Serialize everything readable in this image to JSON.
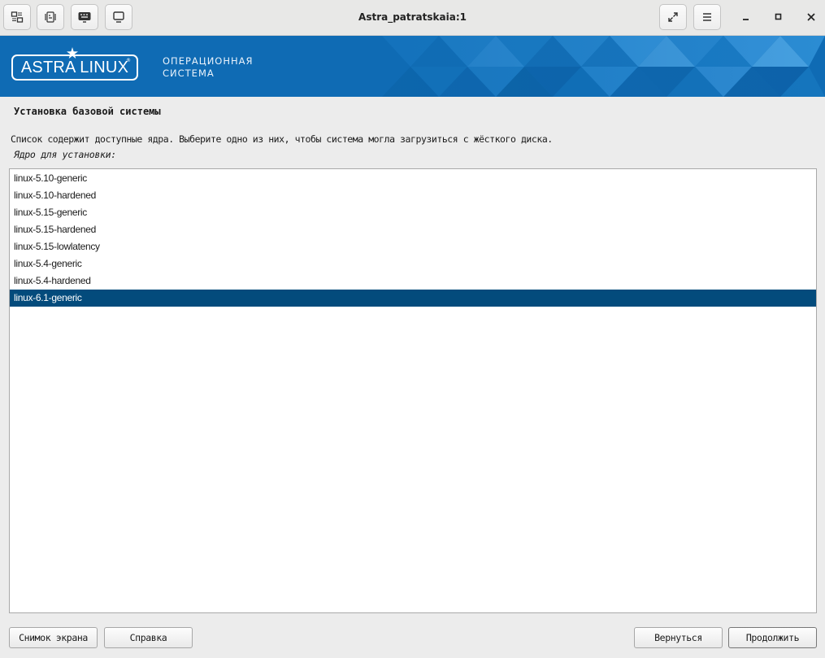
{
  "window": {
    "title": "Astra_patratskaia:1"
  },
  "toolbar": {
    "icons": [
      "display-mode-icon",
      "send-keys-icon",
      "keyboard-icon",
      "monitor-icon",
      "fullscreen-icon",
      "menu-icon",
      "minimize-icon",
      "maximize-icon",
      "close-icon"
    ]
  },
  "banner": {
    "logo": "ASTRA LINUX",
    "subtitle_line1": "ОПЕРАЦИОННАЯ",
    "subtitle_line2": "СИСТЕМА",
    "color": "#0f6bb4"
  },
  "step": {
    "title": "Установка базовой системы",
    "description": "Список содержит доступные ядра. Выберите одно из них, чтобы система могла загрузиться с жёсткого диска.",
    "field_label": "Ядро для установки:"
  },
  "kernels": [
    {
      "label": "linux-5.10-generic",
      "selected": false
    },
    {
      "label": "linux-5.10-hardened",
      "selected": false
    },
    {
      "label": "linux-5.15-generic",
      "selected": false
    },
    {
      "label": "linux-5.15-hardened",
      "selected": false
    },
    {
      "label": "linux-5.15-lowlatency",
      "selected": false
    },
    {
      "label": "linux-5.4-generic",
      "selected": false
    },
    {
      "label": "linux-5.4-hardened",
      "selected": false
    },
    {
      "label": "linux-6.1-generic",
      "selected": true
    }
  ],
  "colors": {
    "selection": "#034b7c"
  },
  "buttons": {
    "screenshot": "Снимок экрана",
    "help": "Справка",
    "back": "Вернуться",
    "continue": "Продолжить"
  }
}
